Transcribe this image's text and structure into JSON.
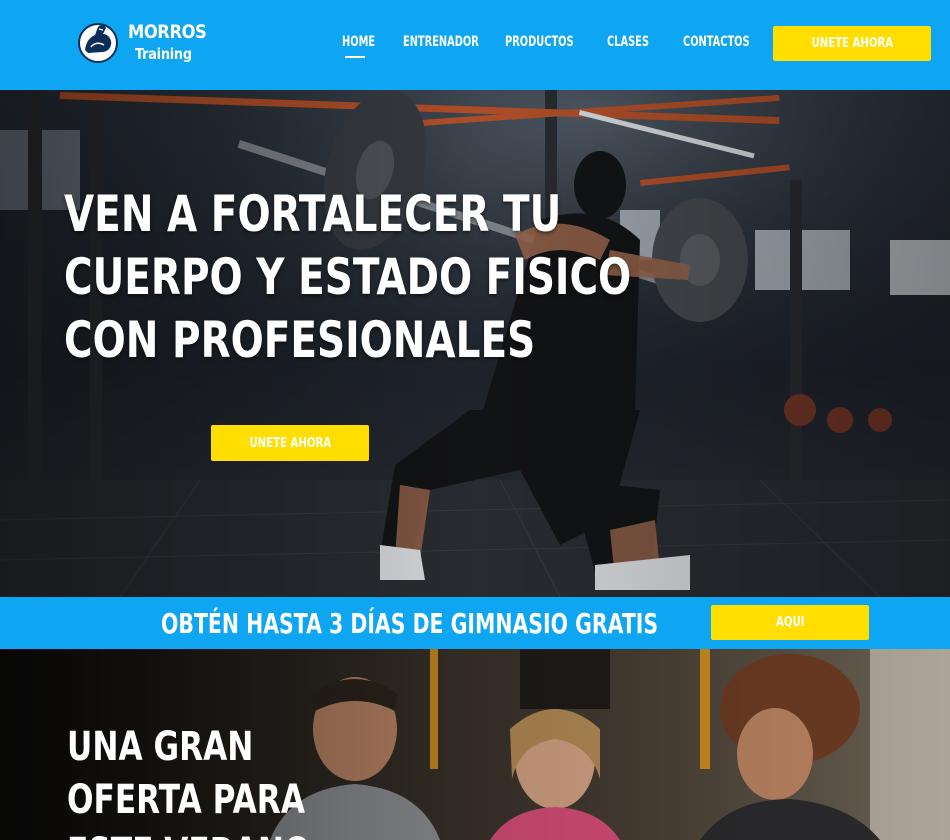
{
  "brand": {
    "name": "MORROS",
    "tagline": "Training",
    "icon": "flexed-arm-icon"
  },
  "nav": {
    "items": [
      {
        "label": "HOME",
        "active": true
      },
      {
        "label": "ENTRENADOR",
        "active": false
      },
      {
        "label": "PRODUCTOS",
        "active": false
      },
      {
        "label": "CLASES",
        "active": false
      },
      {
        "label": "CONTACTOS",
        "active": false
      }
    ],
    "cta_label": "UNETE AHORA"
  },
  "hero": {
    "title_lines": [
      "VEN A FORTALECER TU",
      "CUERPO Y ESTADO FISICO",
      "CON PROFESIONALES"
    ],
    "cta_label": "UNETE AHORA"
  },
  "promo": {
    "text": "OBTÉN HASTA 3 DÍAS DE GIMNASIO GRATIS",
    "cta_label": "AQUI"
  },
  "offer": {
    "title_lines": [
      "UNA GRAN",
      "OFERTA PARA",
      "ESTE VERANO"
    ]
  },
  "colors": {
    "brand_blue": "#0ea5f3",
    "accent_yellow": "#ffde00",
    "text": "#ffffff"
  }
}
